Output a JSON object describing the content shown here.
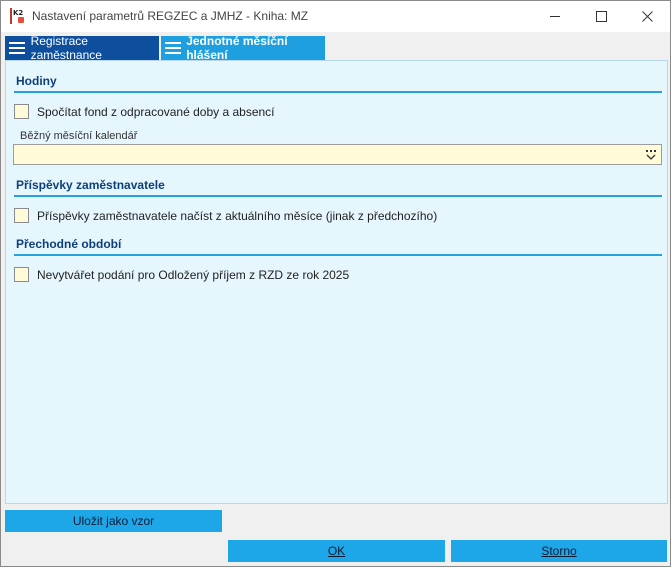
{
  "window": {
    "title": "Nastavení parametrů REGZEC a JMHZ - Kniha: MZ",
    "controls": [
      "minimize-icon",
      "maximize-icon",
      "close-icon"
    ]
  },
  "tabs": [
    {
      "label": "Registrace zaměstnance",
      "active": false
    },
    {
      "label": "Jednotné měsíční hlášení",
      "active": true
    }
  ],
  "sections": {
    "hours": {
      "title": "Hodiny",
      "checkbox_label": "Spočítat fond z odpracované doby a absencí",
      "checked": false,
      "calendar_label": "Běžný měsíční kalendář",
      "calendar_value": ""
    },
    "contributions": {
      "title": "Příspěvky zaměstnavatele",
      "checkbox_label": "Příspěvky zaměstnavatele načíst z aktuálního měsíce (jinak z předchozího)",
      "checked": false
    },
    "transition": {
      "title": "Přechodné období",
      "checkbox_label": "Nevytvářet podání pro Odložený příjem z RZD ze rok 2025",
      "checked": false
    }
  },
  "buttons": {
    "save_template": "Uložit jako vzor",
    "ok": "OK",
    "cancel": "Storno"
  },
  "colors": {
    "panel_bg": "#e5f6fd",
    "accent": "#1ea7e8",
    "tab_dark": "#0d4f9c",
    "section_title": "#0d3f7a",
    "field_bg": "#fffbd8"
  }
}
